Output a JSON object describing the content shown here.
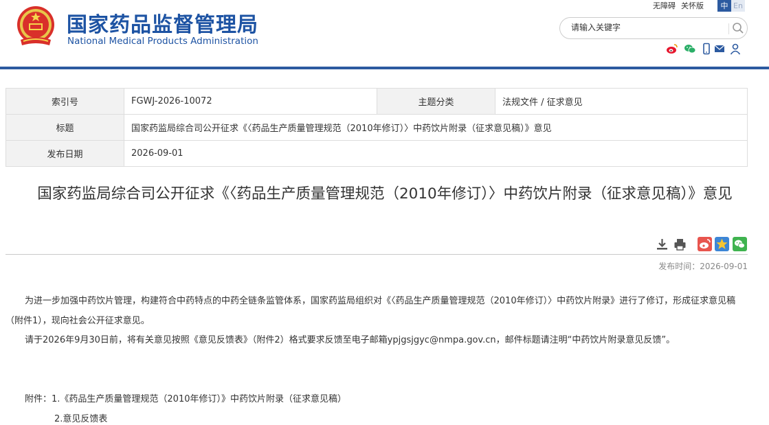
{
  "header": {
    "title_cn": "国家药品监督管理局",
    "title_en": "National Medical Products Administration",
    "top_links": [
      "无障碍",
      "关怀版"
    ],
    "lang_zh": "中",
    "lang_en": "En",
    "search_placeholder": "请输入关键字",
    "social_icons": [
      "weibo-icon",
      "wechat-icon",
      "mobile-icon",
      "mail-icon",
      "user-icon"
    ]
  },
  "info": {
    "index_label": "索引号",
    "index_value": "FGWJ-2026-10072",
    "topic_label": "主题分类",
    "topic_value": "法规文件 / 征求意见",
    "title_label": "标题",
    "title_value": "国家药监局综合司公开征求《〈药品生产质量管理规范（2010年修订）〉中药饮片附录（征求意见稿）》意见",
    "date_label": "发布日期",
    "date_value": "2026-09-01"
  },
  "article": {
    "title": "国家药监局综合司公开征求《〈药品生产质量管理规范（2010年修订）〉中药饮片附录（征求意见稿）》意见",
    "share_icons": [
      "download-icon",
      "print-icon",
      "weibo-share-icon",
      "qzone-share-icon",
      "wechat-share-icon"
    ],
    "pub_time": "发布时间：2026-09-01",
    "paragraphs": [
      "为进一步加强中药饮片管理，构建符合中药特点的中药全链条监管体系，国家药监局组织对《〈药品生产质量管理规范（2010年修订）〉中药饮片附录》进行了修订，形成征求意见稿（附件1），现向社会公开征求意见。",
      "请于2026年9月30日前，将有关意见按照《意见反馈表》（附件2）格式要求反馈至电子邮箱ypjgsjgyc@nmpa.gov.cn，邮件标题请注明“中药饮片附录意见反馈”。"
    ],
    "attachment_1": "附件：1.《药品生产质量管理规范（2010年修订）》中药饮片附录（征求意见稿）",
    "attachment_2": "2.意见反馈表"
  },
  "colors": {
    "brand": "#1d53a3",
    "bar": "#2c5aa0"
  }
}
